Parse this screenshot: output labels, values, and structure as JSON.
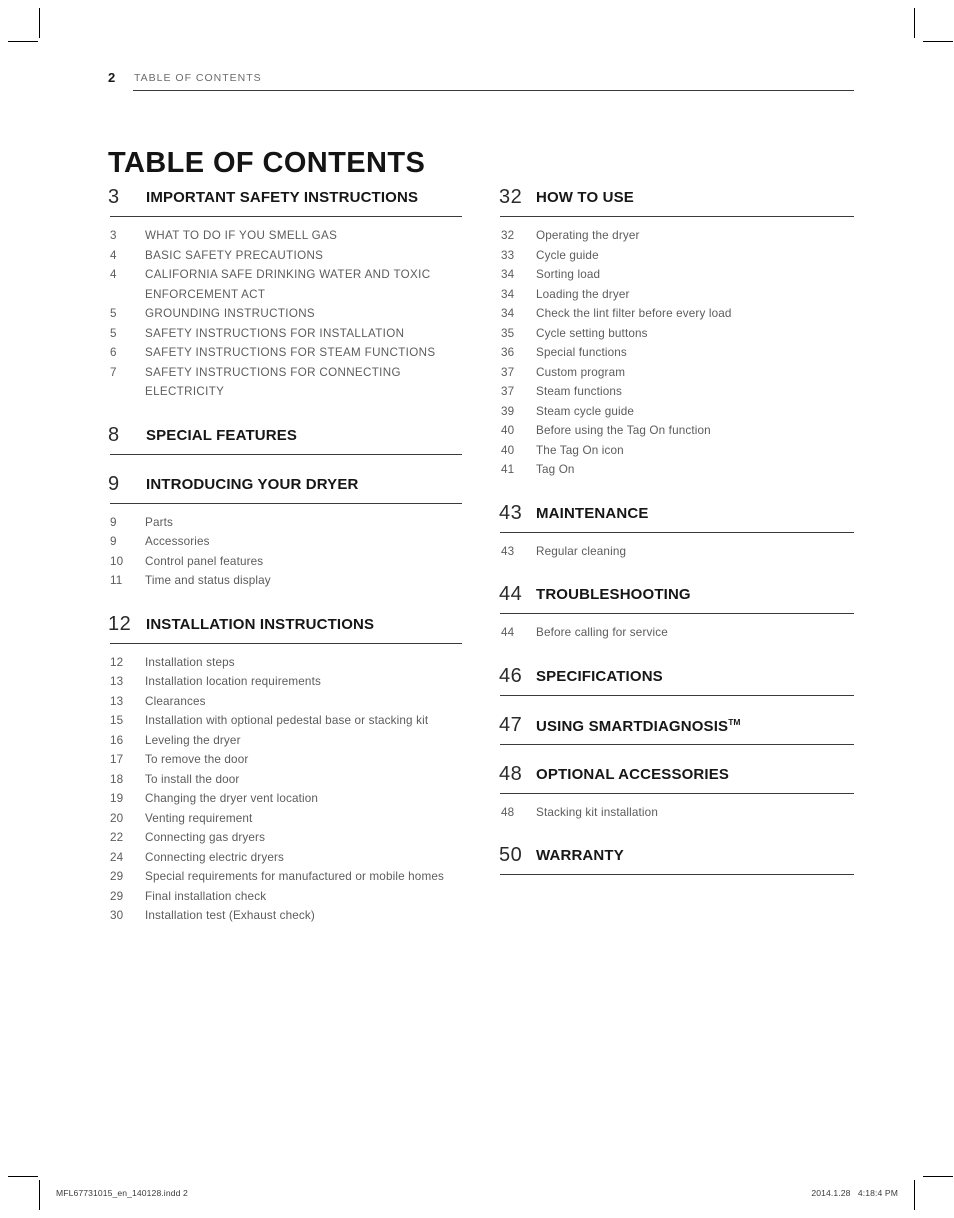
{
  "header": {
    "page_number": "2",
    "running_title": "TABLE OF CONTENTS"
  },
  "title": "TABLE OF CONTENTS",
  "columns": {
    "left": [
      {
        "number": "3",
        "label": "IMPORTANT SAFETY INSTRUCTIONS",
        "style": "caps",
        "entries": [
          {
            "number": "3",
            "text": "WHAT TO DO IF YOU SMELL GAS"
          },
          {
            "number": "4",
            "text": "BASIC SAFETY PRECAUTIONS"
          },
          {
            "number": "4",
            "text": "CALIFORNIA SAFE DRINKING WATER AND TOXIC ENFORCEMENT ACT"
          },
          {
            "number": "5",
            "text": "GROUNDING INSTRUCTIONS"
          },
          {
            "number": "5",
            "text": "SAFETY INSTRUCTIONS FOR INSTALLATION"
          },
          {
            "number": "6",
            "text": "SAFETY INSTRUCTIONS FOR STEAM FUNCTIONS"
          },
          {
            "number": "7",
            "text": "SAFETY INSTRUCTIONS FOR CONNECTING ELECTRICITY"
          }
        ]
      },
      {
        "number": "8",
        "label": "SPECIAL FEATURES",
        "style": "normal",
        "entries": []
      },
      {
        "number": "9",
        "label": "INTRODUCING YOUR DRYER",
        "style": "normal",
        "entries": [
          {
            "number": "9",
            "text": "Parts"
          },
          {
            "number": "9",
            "text": "Accessories"
          },
          {
            "number": "10",
            "text": "Control panel features"
          },
          {
            "number": "11",
            "text": "Time and status display"
          }
        ]
      },
      {
        "number": "12",
        "label": "INSTALLATION INSTRUCTIONS",
        "style": "normal",
        "entries": [
          {
            "number": "12",
            "text": "Installation steps"
          },
          {
            "number": "13",
            "text": "Installation location requirements"
          },
          {
            "number": "13",
            "text": "Clearances"
          },
          {
            "number": "15",
            "text": "Installation with optional pedestal base or stacking kit"
          },
          {
            "number": "16",
            "text": "Leveling the dryer"
          },
          {
            "number": "17",
            "text": "To remove the door"
          },
          {
            "number": "18",
            "text": "To install the door"
          },
          {
            "number": "19",
            "text": "Changing the dryer vent location"
          },
          {
            "number": "20",
            "text": "Venting requirement"
          },
          {
            "number": "22",
            "text": "Connecting gas dryers"
          },
          {
            "number": "24",
            "text": "Connecting electric dryers"
          },
          {
            "number": "29",
            "text": "Special requirements for manufactured or mobile homes"
          },
          {
            "number": "29",
            "text": "Final installation check"
          },
          {
            "number": "30",
            "text": "Installation test (Exhaust check)"
          }
        ]
      }
    ],
    "right": [
      {
        "number": "32",
        "label": "HOW TO USE",
        "style": "normal",
        "entries": [
          {
            "number": "32",
            "text": "Operating the dryer"
          },
          {
            "number": "33",
            "text": "Cycle guide"
          },
          {
            "number": "34",
            "text": "Sorting load"
          },
          {
            "number": "34",
            "text": "Loading the dryer"
          },
          {
            "number": "34",
            "text": "Check the lint filter before every load"
          },
          {
            "number": "35",
            "text": "Cycle setting buttons"
          },
          {
            "number": "36",
            "text": "Special functions"
          },
          {
            "number": "37",
            "text": "Custom program"
          },
          {
            "number": "37",
            "text": "Steam functions"
          },
          {
            "number": "39",
            "text": "Steam cycle guide"
          },
          {
            "number": "40",
            "text": "Before using the Tag On function"
          },
          {
            "number": "40",
            "text": "The Tag On icon"
          },
          {
            "number": "41",
            "text": "Tag On"
          }
        ]
      },
      {
        "number": "43",
        "label": "MAINTENANCE",
        "style": "normal",
        "entries": [
          {
            "number": "43",
            "text": "Regular cleaning"
          }
        ]
      },
      {
        "number": "44",
        "label": "TROUBLESHOOTING",
        "style": "normal",
        "entries": [
          {
            "number": "44",
            "text": "Before calling for service"
          }
        ]
      },
      {
        "number": "46",
        "label": "SPECIFICATIONS",
        "style": "normal",
        "entries": []
      },
      {
        "number": "47",
        "label": "USING SMARTDIAGNOSIS",
        "superscript": "TM",
        "style": "normal",
        "entries": []
      },
      {
        "number": "48",
        "label": "OPTIONAL ACCESSORIES",
        "style": "normal",
        "entries": [
          {
            "number": "48",
            "text": "Stacking kit installation"
          }
        ]
      },
      {
        "number": "50",
        "label": "WARRANTY",
        "style": "normal",
        "entries": []
      }
    ]
  },
  "footer": {
    "file_name": "MFL67731015_en_140128.indd   2",
    "timestamp": "2014.1.28   4:18:4 PM"
  },
  "colors": {
    "heading_text": "#161616",
    "body_text": "#5c5c5c",
    "rule": "#3b3b3b",
    "page_background": "#ffffff"
  }
}
